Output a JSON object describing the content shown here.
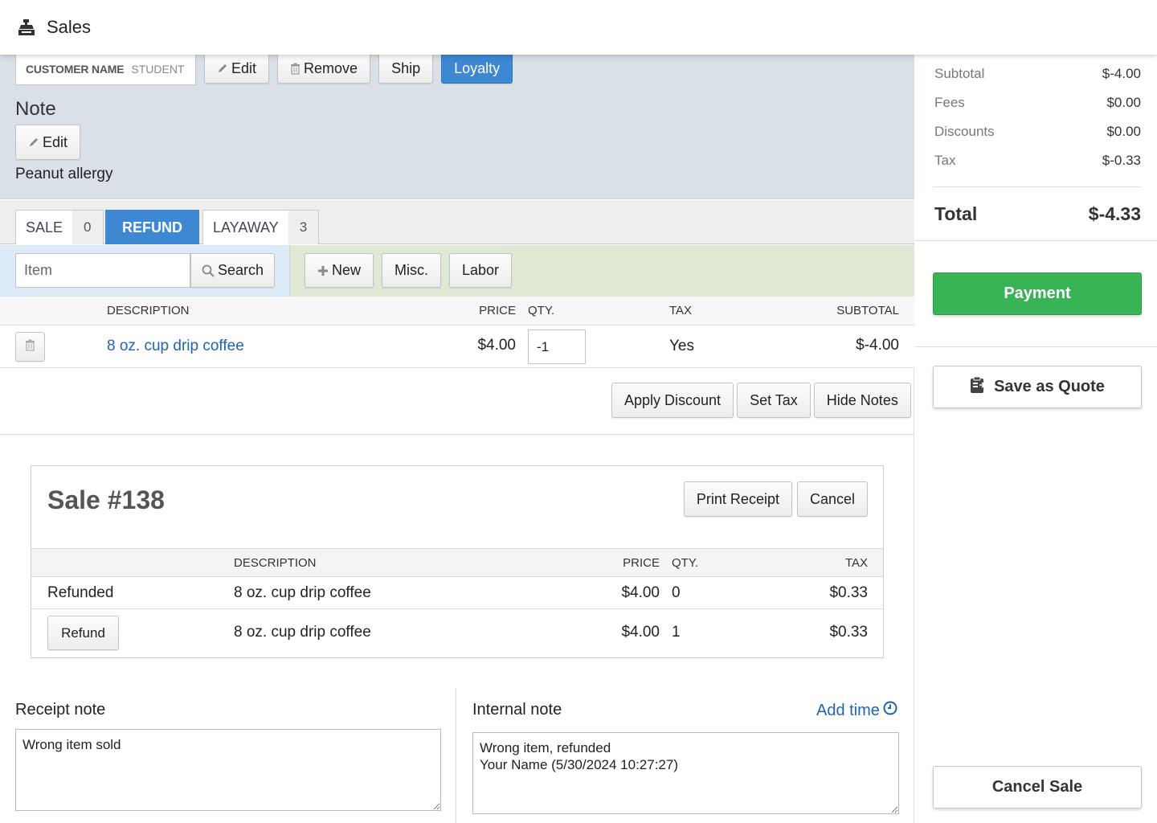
{
  "app": {
    "title": "Sales",
    "icon": "cash-register-icon"
  },
  "customer": {
    "name_label": "CUSTOMER NAME",
    "name_value": "STUDENT",
    "edit_label": "Edit",
    "remove_label": "Remove",
    "ship_label": "Ship",
    "loyalty_label": "Loyalty"
  },
  "note": {
    "title": "Note",
    "edit_label": "Edit",
    "text": "Peanut allergy"
  },
  "tabs": [
    {
      "label": "SALE",
      "count": "0",
      "active": false
    },
    {
      "label": "REFUND",
      "count": "",
      "active": true
    },
    {
      "label": "LAYAWAY",
      "count": "3",
      "active": false
    }
  ],
  "search": {
    "item_placeholder": "Item",
    "search_label": "Search",
    "new_label": "New",
    "misc_label": "Misc.",
    "labor_label": "Labor"
  },
  "items_table": {
    "headers": {
      "description": "DESCRIPTION",
      "price": "PRICE",
      "qty": "QTY.",
      "tax": "TAX",
      "subtotal": "SUBTOTAL"
    },
    "rows": [
      {
        "description": "8 oz. cup drip coffee",
        "price": "$4.00",
        "qty": "-1",
        "tax": "Yes",
        "subtotal": "$-4.00"
      }
    ]
  },
  "actions": {
    "apply_discount": "Apply Discount",
    "set_tax": "Set Tax",
    "hide_notes": "Hide Notes"
  },
  "sale": {
    "title": "Sale #138",
    "print_receipt": "Print Receipt",
    "cancel": "Cancel",
    "headers": {
      "description": "DESCRIPTION",
      "price": "PRICE",
      "qty": "QTY.",
      "tax": "TAX"
    },
    "rows": [
      {
        "status": "Refunded",
        "description": "8 oz. cup drip coffee",
        "price": "$4.00",
        "qty": "0",
        "tax": "$0.33"
      },
      {
        "action": "Refund",
        "description": "8 oz. cup drip coffee",
        "price": "$4.00",
        "qty": "1",
        "tax": "$0.33"
      }
    ]
  },
  "notes": {
    "receipt_label": "Receipt note",
    "receipt_value": "Wrong item sold",
    "internal_label": "Internal note",
    "internal_value": "Wrong item, refunded\nYour Name (5/30/2024 10:27:27)",
    "add_time_label": "Add time"
  },
  "summary": {
    "rows": [
      {
        "label": "Subtotal",
        "value": "$-4.00"
      },
      {
        "label": "Fees",
        "value": "$0.00"
      },
      {
        "label": "Discounts",
        "value": "$0.00"
      },
      {
        "label": "Tax",
        "value": "$-0.33"
      }
    ],
    "total_label": "Total",
    "total_value": "$-4.33",
    "payment_label": "Payment",
    "save_quote_label": "Save as Quote",
    "cancel_sale_label": "Cancel Sale"
  },
  "colors": {
    "accent_blue": "#3d87d3",
    "link_blue": "#1f64b0",
    "payment_green": "#38b457",
    "customer_panel_bg": "#d9e0e7",
    "search_bg": "#ddebf8",
    "actions_bg": "#dfe8d4"
  }
}
